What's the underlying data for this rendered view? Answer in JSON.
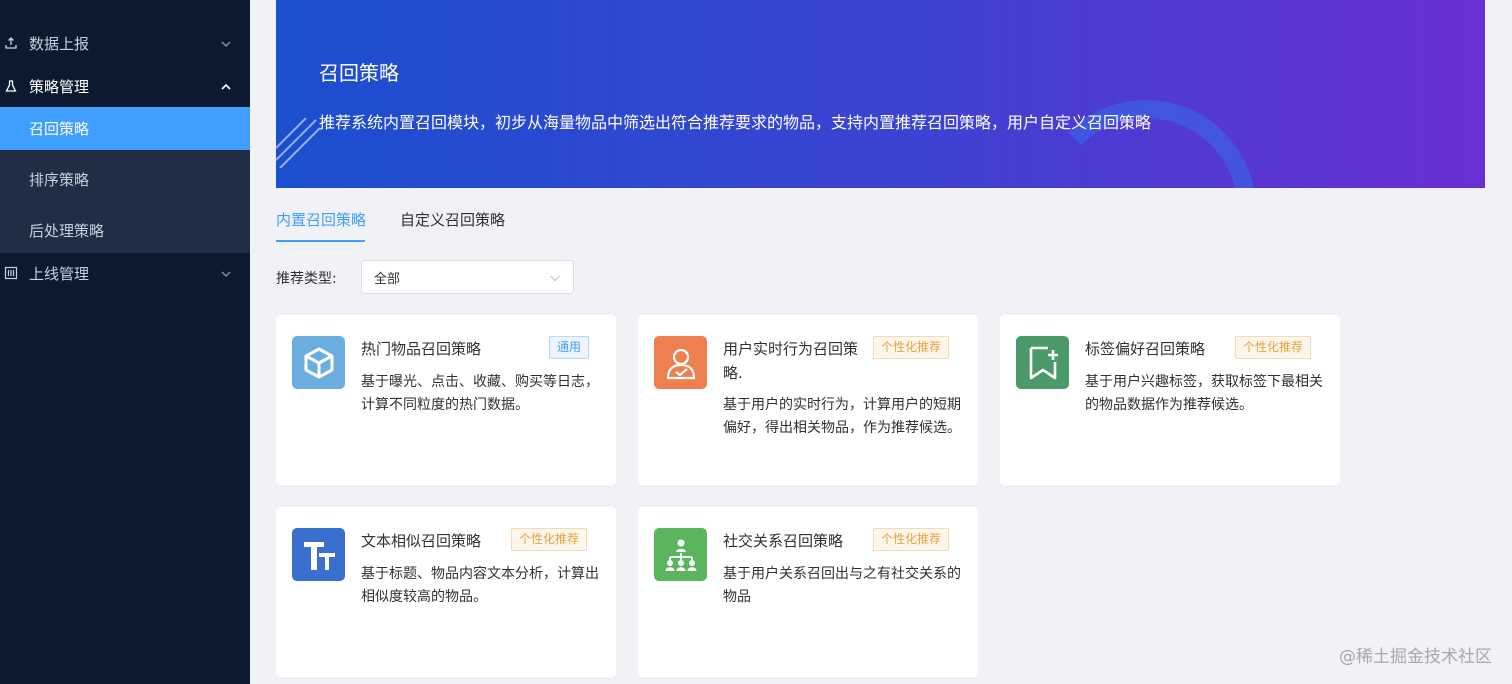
{
  "sidebar": {
    "items": [
      {
        "label": "数据上报",
        "icon": "upload-icon",
        "expanded": false
      },
      {
        "label": "策略管理",
        "icon": "flask-icon",
        "expanded": true
      },
      {
        "label": "上线管理",
        "icon": "sliders-icon",
        "expanded": false
      }
    ],
    "subitems": [
      {
        "label": "召回策略",
        "active": true
      },
      {
        "label": "排序策略",
        "active": false
      },
      {
        "label": "后处理策略",
        "active": false
      }
    ]
  },
  "banner": {
    "title": "召回策略",
    "description": "推荐系统内置召回模块，初步从海量物品中筛选出符合推荐要求的物品，支持内置推荐召回策略，用户自定义召回策略"
  },
  "tabs": [
    {
      "label": "内置召回策略",
      "active": true
    },
    {
      "label": "自定义召回策略",
      "active": false
    }
  ],
  "filter": {
    "label": "推荐类型:",
    "selected": "全部"
  },
  "cards": [
    {
      "title": "热门物品召回策略",
      "tag": "通用",
      "tag_type": "general",
      "description": "基于曝光、点击、收藏、购买等日志，计算不同粒度的热门数据。",
      "icon": "cube-icon",
      "icon_color": "#6aaee0"
    },
    {
      "title": "用户实时行为召回策略.",
      "tag": "个性化推荐",
      "tag_type": "personal",
      "description": "基于用户的实时行为，计算用户的短期偏好，得出相关物品，作为推荐候选。",
      "icon": "user-check-icon",
      "icon_color": "#ee7f4e"
    },
    {
      "title": "标签偏好召回策略",
      "tag": "个性化推荐",
      "tag_type": "personal",
      "description": "基于用户兴趣标签，获取标签下最相关的物品数据作为推荐候选。",
      "icon": "bookmark-add-icon",
      "icon_color": "#4a9a6a"
    },
    {
      "title": "文本相似召回策略",
      "tag": "个性化推荐",
      "tag_type": "personal",
      "description": "基于标题、物品内容文本分析，计算出相似度较高的物品。",
      "icon": "text-icon",
      "icon_color": "#3a6fd0"
    },
    {
      "title": "社交关系召回策略",
      "tag": "个性化推荐",
      "tag_type": "personal",
      "description": "基于用户关系召回出与之有社交关系的物品",
      "icon": "social-network-icon",
      "icon_color": "#5bb45e"
    }
  ],
  "watermark": "@稀土掘金技术社区"
}
